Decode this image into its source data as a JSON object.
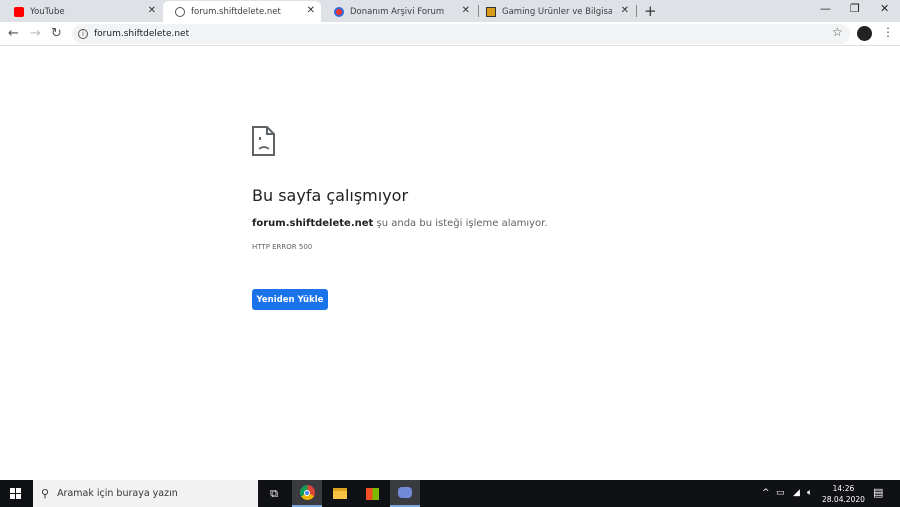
{
  "tabs": [
    {
      "title": "YouTube",
      "icon": "youtube-icon",
      "active": false
    },
    {
      "title": "forum.shiftdelete.net",
      "icon": "globe-icon",
      "active": true
    },
    {
      "title": "Donanım Arşivi Forum",
      "icon": "donanim-arsivi-icon",
      "active": false
    },
    {
      "title": "Gaming Ürünler ve Bilgisayar Bile",
      "icon": "gaming-site-icon",
      "active": false
    }
  ],
  "toolbar": {
    "url": "forum.shiftdelete.net"
  },
  "error": {
    "title": "Bu sayfa çalışmıyor",
    "host": "forum.shiftdelete.net",
    "message": " şu anda bu isteği işleme alamıyor.",
    "code": "HTTP ERROR 500",
    "reload_label": "Yeniden Yükle"
  },
  "taskbar": {
    "search_placeholder": "Aramak için buraya yazın",
    "time": "14:26",
    "date": "28.04.2020"
  },
  "colors": {
    "accent": "#1a73e8",
    "tabstrip": "#dee1e6",
    "taskbar": "#101114"
  }
}
